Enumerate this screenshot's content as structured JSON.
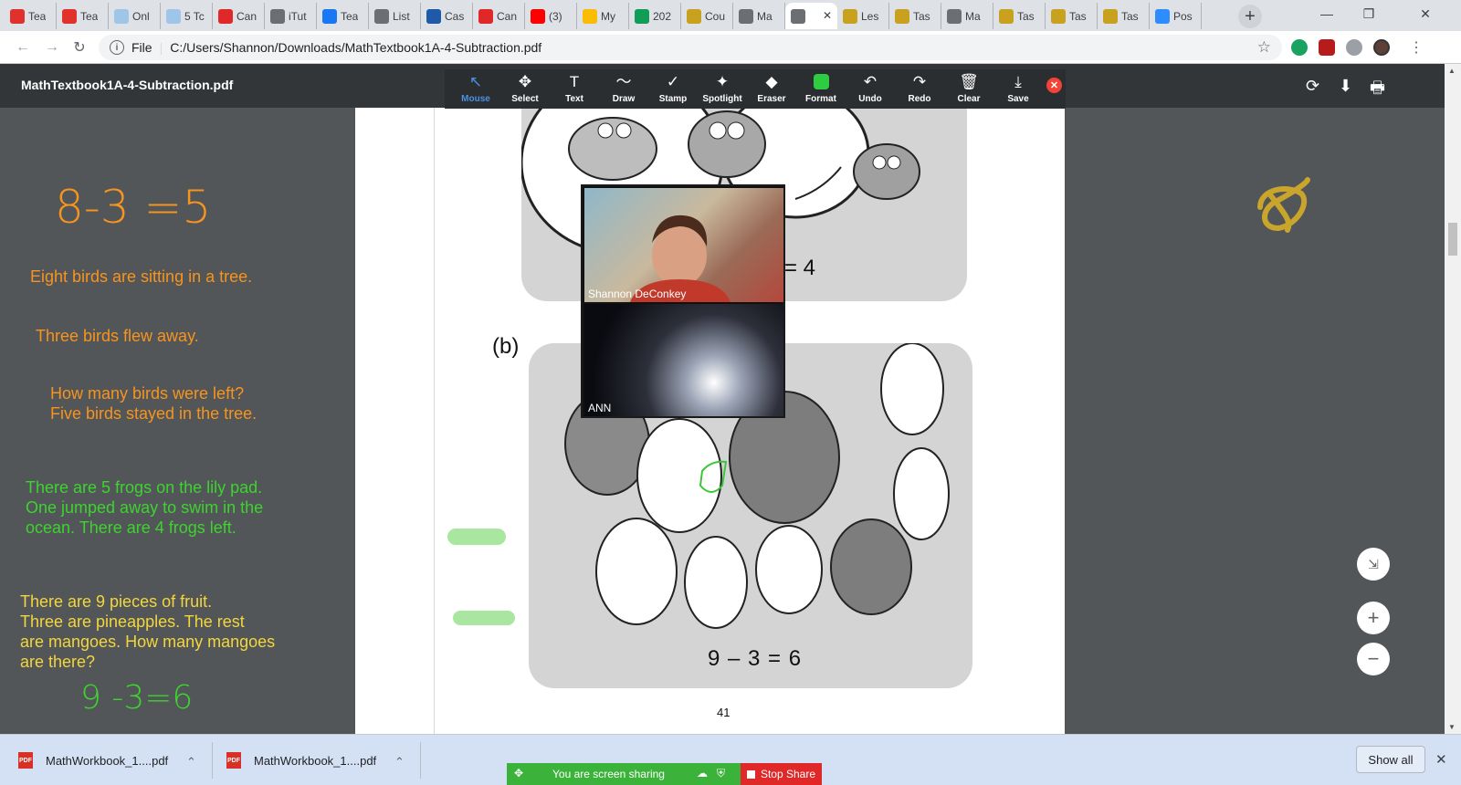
{
  "browser": {
    "tabs": [
      {
        "title": "Tea",
        "icon": "i",
        "color": "#e0312d"
      },
      {
        "title": "Tea",
        "icon": "i",
        "color": "#e0312d"
      },
      {
        "title": "Onl",
        "icon": "OET",
        "color": "#9fc5e8"
      },
      {
        "title": "5 Tc",
        "icon": "OET",
        "color": "#9fc5e8"
      },
      {
        "title": "Can",
        "icon": "play",
        "color": "#e02828"
      },
      {
        "title": "iTut",
        "icon": "globe",
        "color": "#6b6f74"
      },
      {
        "title": "Tea",
        "icon": "f",
        "color": "#1877f2"
      },
      {
        "title": "List",
        "icon": "globe",
        "color": "#6b6f74"
      },
      {
        "title": "Cas",
        "icon": "L",
        "color": "#1e5aa8"
      },
      {
        "title": "Can",
        "icon": "play",
        "color": "#e02828"
      },
      {
        "title": "(3)",
        "icon": "yt",
        "color": "#ff0000"
      },
      {
        "title": "My",
        "icon": "drive",
        "color": "#fbbc04"
      },
      {
        "title": "202",
        "icon": "+",
        "color": "#0f9d58"
      },
      {
        "title": "Cou",
        "icon": "doc",
        "color": "#c8a21e"
      },
      {
        "title": "Ma",
        "icon": "globe",
        "color": "#6b6f74"
      },
      {
        "title": "",
        "icon": "globe",
        "color": "#6b6f74",
        "active": true
      },
      {
        "title": "Les",
        "icon": "doc",
        "color": "#c8a21e"
      },
      {
        "title": "Tas",
        "icon": "doc",
        "color": "#c8a21e"
      },
      {
        "title": "Ma",
        "icon": "globe",
        "color": "#6b6f74"
      },
      {
        "title": "Tas",
        "icon": "doc",
        "color": "#c8a21e"
      },
      {
        "title": "Tas",
        "icon": "doc",
        "color": "#c8a21e"
      },
      {
        "title": "Tas",
        "icon": "doc",
        "color": "#c8a21e"
      },
      {
        "title": "Pos",
        "icon": "zoom",
        "color": "#2d8cff"
      }
    ],
    "new_tab": "+",
    "active_tab_close": "✕",
    "window_controls": {
      "minimize": "—",
      "restore": "❐",
      "close": "✕"
    },
    "address": {
      "scheme_label": "File",
      "url": "C:/Users/Shannon/Downloads/MathTextbook1A-4-Subtraction.pdf"
    }
  },
  "viewer": {
    "file_name": "MathTextbook1A-4-Subtraction.pdf",
    "tools": [
      {
        "label": "Mouse",
        "icon": "↖",
        "selected": true
      },
      {
        "label": "Select",
        "icon": "✥"
      },
      {
        "label": "Text",
        "icon": "T"
      },
      {
        "label": "Draw",
        "icon": "〜"
      },
      {
        "label": "Stamp",
        "icon": "✓"
      },
      {
        "label": "Spotlight",
        "icon": "✦"
      },
      {
        "label": "Eraser",
        "icon": "◆"
      },
      {
        "label": "Format",
        "icon": "swatch"
      },
      {
        "label": "Undo",
        "icon": "↶"
      },
      {
        "label": "Redo",
        "icon": "↷"
      },
      {
        "label": "Clear",
        "icon": "🗑"
      },
      {
        "label": "Save",
        "icon": "⤓"
      }
    ],
    "annotation_close": "✕",
    "right_buttons": {
      "rotate": "⟳",
      "download": "⬇",
      "print": "🖶"
    }
  },
  "pdf_page": {
    "equation_a_partial": "= 4",
    "label_b": "(b)",
    "equation_b": "9 – 3 = 6",
    "page_number": "41"
  },
  "video": {
    "top_participant": "Shannon DeConkey",
    "bottom_participant": "ANN"
  },
  "notes": {
    "handwritten_1": "8-3 =5",
    "line1": "Eight birds are sitting in a tree.",
    "line2": "Three birds flew away.",
    "line3": "How many birds were left?",
    "line4": "Five birds stayed in the tree.",
    "frogs": [
      "There are 5 frogs on the lily pad.",
      "One jumped away to swim in the",
      "ocean.  There are 4 frogs left."
    ],
    "fruit": [
      "There are 9 pieces of fruit.",
      "Three are pineapples.  The rest",
      "are mangoes. How many mangoes",
      "are there?"
    ],
    "handwritten_2": "9 -3=6"
  },
  "zoom_controls": {
    "fit": "⇲",
    "zoom_in": "+",
    "zoom_out": "−"
  },
  "downloads": {
    "items": [
      {
        "name": "MathWorkbook_1....pdf"
      },
      {
        "name": "MathWorkbook_1....pdf"
      }
    ],
    "icon_text": "PDF",
    "chevron": "⌃",
    "show_all": "Show all",
    "close": "✕"
  },
  "share": {
    "status": "You are screen sharing",
    "stop": "Stop Share"
  },
  "colors": {
    "orange_notes": "#f7941d",
    "green_notes": "#3ed32e",
    "yellow_notes": "#f3d63c",
    "share_green": "#3bb33b",
    "stop_red": "#e02828"
  }
}
